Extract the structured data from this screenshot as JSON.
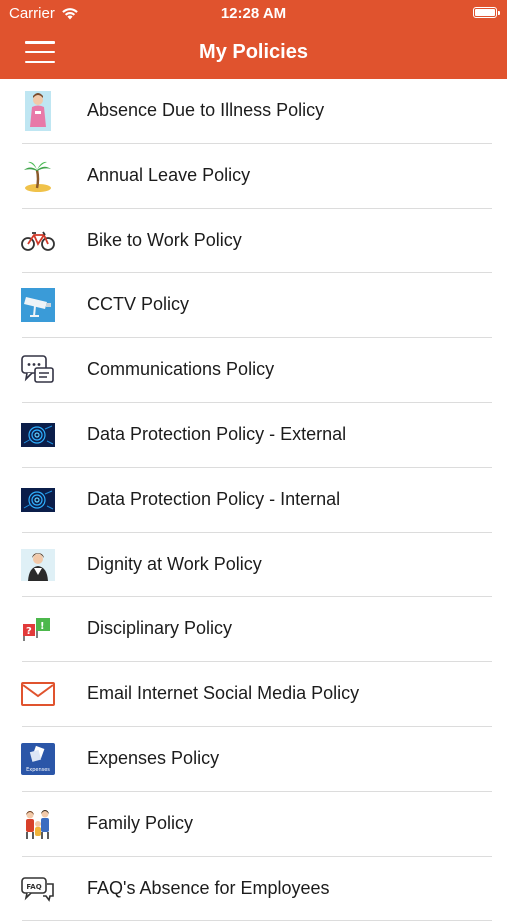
{
  "status_bar": {
    "carrier": "Carrier",
    "time": "12:28 AM",
    "wifi_icon": "wifi-icon",
    "battery_icon": "battery-icon"
  },
  "nav_bar": {
    "title": "My Policies",
    "menu_icon": "hamburger-menu-icon",
    "background_color": "#e0532e"
  },
  "policies": [
    {
      "label": "Absence Due to Illness Policy",
      "icon": "sick-person-icon"
    },
    {
      "label": "Annual Leave Policy",
      "icon": "palm-island-icon"
    },
    {
      "label": "Bike to Work Policy",
      "icon": "bicycle-icon"
    },
    {
      "label": "CCTV Policy",
      "icon": "cctv-camera-icon"
    },
    {
      "label": "Communications Policy",
      "icon": "chat-bubbles-icon"
    },
    {
      "label": "Data Protection Policy - External",
      "icon": "data-fingerprint-icon"
    },
    {
      "label": "Data Protection Policy - Internal",
      "icon": "data-fingerprint-icon"
    },
    {
      "label": "Dignity at Work Policy",
      "icon": "worker-icon"
    },
    {
      "label": "Disciplinary Policy",
      "icon": "warning-flags-icon"
    },
    {
      "label": "Email Internet Social Media Policy",
      "icon": "envelope-icon"
    },
    {
      "label": "Expenses Policy",
      "icon": "expenses-icon"
    },
    {
      "label": "Family Policy",
      "icon": "family-icon"
    },
    {
      "label": "FAQ's Absence for Employees",
      "icon": "faq-bubble-icon"
    }
  ],
  "expenses_icon_text": "Expenses",
  "faq_icon_text": "FAQ"
}
